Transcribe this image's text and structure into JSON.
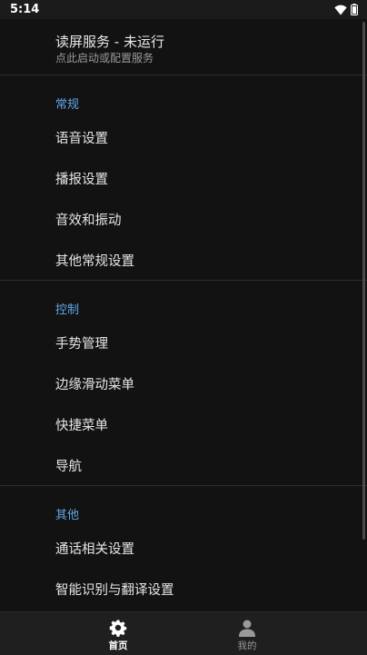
{
  "status_bar": {
    "time": "5:14",
    "wifi_icon": "wifi-icon",
    "battery_icon": "battery-icon"
  },
  "service": {
    "title": "读屏服务 - 未运行",
    "subtitle": "点此启动或配置服务"
  },
  "sections": [
    {
      "header": "常规",
      "items": [
        "语音设置",
        "播报设置",
        "音效和振动",
        "其他常规设置"
      ]
    },
    {
      "header": "控制",
      "items": [
        "手势管理",
        "边缘滑动菜单",
        "快捷菜单",
        "导航"
      ]
    },
    {
      "header": "其他",
      "items": [
        "通话相关设置",
        "智能识别与翻译设置"
      ]
    }
  ],
  "bottom_nav": {
    "home": {
      "label": "首页",
      "icon": "gear-icon"
    },
    "me": {
      "label": "我的",
      "icon": "person-icon"
    }
  },
  "colors": {
    "accent": "#61a6e6",
    "background": "#121212",
    "nav_background": "#1f1f1f"
  }
}
